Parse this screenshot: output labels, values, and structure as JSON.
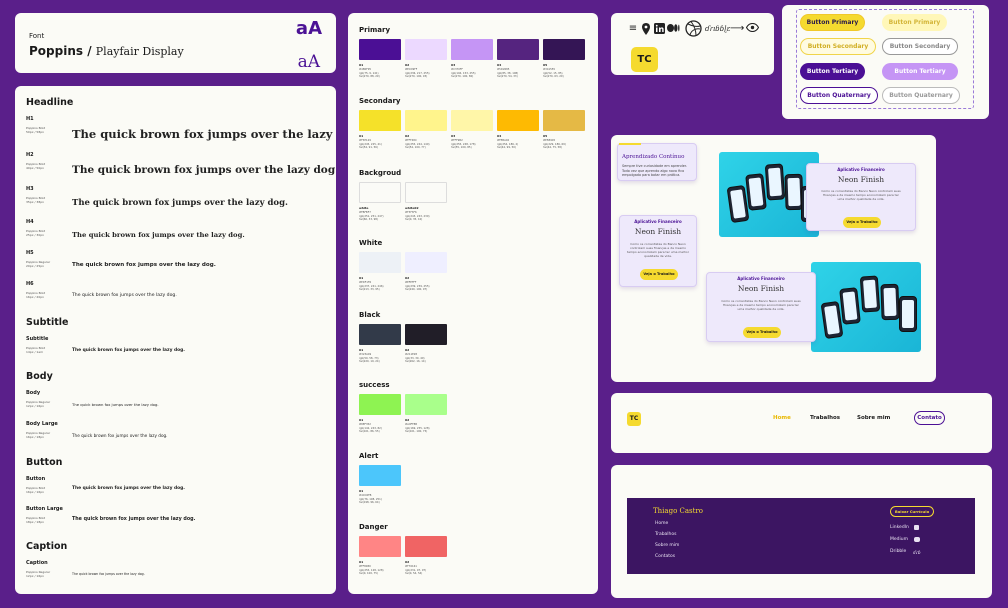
{
  "font": {
    "label": "Font",
    "family_a": "Poppins",
    "sep": " / ",
    "family_b": "Playfair Display",
    "aa_sans": "aA",
    "aa_serif": "aA"
  },
  "typography": {
    "sections": [
      {
        "title": "Headline"
      },
      {
        "title": "Subtitle"
      },
      {
        "title": "Body"
      },
      {
        "title": "Button"
      },
      {
        "title": "Caption"
      }
    ],
    "rows": [
      {
        "tag": "H1",
        "meta1": "Poppins Bold",
        "meta2": "50px / 58px",
        "sample": "The quick brown fox jumps over the lazy dog."
      },
      {
        "tag": "H2",
        "meta1": "Poppins Bold",
        "meta2": "40px / 50px",
        "sample": "The quick brown fox jumps over the lazy dog."
      },
      {
        "tag": "H3",
        "meta1": "Poppins Bold",
        "meta2": "35px / 38px",
        "sample": "The quick brown fox jumps over the lazy dog."
      },
      {
        "tag": "H4",
        "meta1": "Poppins Bold",
        "meta2": "25px / 30px",
        "sample": "The quick brown fox jumps over the lazy dog."
      },
      {
        "tag": "H5",
        "meta1": "Poppins Regular",
        "meta2": "20px / 25px",
        "sample": "The quick brown fox jumps over the lazy dog."
      },
      {
        "tag": "H6",
        "meta1": "Poppins Bold",
        "meta2": "16px / 20px",
        "sample": "The quick brown fox jumps over the lazy dog."
      },
      {
        "tag": "Subtitle",
        "meta1": "Poppins Bold",
        "meta2": "14px / 1em",
        "sample": "The quick brown fox jumps over the lazy dog."
      },
      {
        "tag": "Body",
        "meta1": "Poppins Regular",
        "meta2": "12px / 16px",
        "sample": "The quick brown fox jumps over the lazy dog."
      },
      {
        "tag": "Body Large",
        "meta1": "Poppins Regular",
        "meta2": "16px / 18px",
        "sample": "The quick brown fox jumps over the lazy dog."
      },
      {
        "tag": "Button",
        "meta1": "Poppins Bold",
        "meta2": "16px / 16px",
        "sample": "The quick brown fox jumps over the lazy dog."
      },
      {
        "tag": "Button Large",
        "meta1": "Poppins Bold",
        "meta2": "18px / 18px",
        "sample": "The quick brown fox jumps over the lazy dog."
      },
      {
        "tag": "Caption",
        "meta1": "Poppins Regular",
        "meta2": "12px / 16px",
        "sample": "The quick brown fox jumps over the lazy dog."
      }
    ]
  },
  "palette": {
    "groups": [
      {
        "name": "Primary",
        "swatches": [
          {
            "id": "01",
            "hex": "#4B0F95",
            "rgb": "rgb(75, 9, 141)",
            "hsl": "hsl(270, 88, 29)",
            "color": "#4b0f95"
          },
          {
            "id": "02",
            "hex": "#ECD9FF",
            "rgb": "rgb(236, 217, 255)",
            "hsl": "hsl(270, 100, 93)",
            "color": "#ecd9ff"
          },
          {
            "id": "03",
            "hex": "#C370FF",
            "rgb": "rgb(194, 153, 255)",
            "hsl": "hsl(270, 100, 80)",
            "color": "#c595f5"
          },
          {
            "id": "04",
            "hex": "#5D2685",
            "rgb": "rgb(85, 38, 108)",
            "hsl": "hsl(270, 54, 33)",
            "color": "#55247f"
          },
          {
            "id": "05",
            "hex": "#341555",
            "rgb": "rgb(52, 15, 85)",
            "hsl": "hsl(270, 63, 20)",
            "color": "#341555"
          }
        ]
      },
      {
        "name": "Secondary",
        "swatches": [
          {
            "id": "01",
            "hex": "#F5E129",
            "rgb": "rgb(245, 225, 41)",
            "hsl": "hsl(54, 91, 56)",
            "color": "#f5e129"
          },
          {
            "id": "02",
            "hex": "#FFF48C",
            "rgb": "rgb(255, 244, 140)",
            "hsl": "hsl(54, 100, 77)",
            "color": "#fff48c"
          },
          {
            "id": "03",
            "hex": "#FFF9B2",
            "rgb": "rgb(255, 248, 178)",
            "hsl": "hsl(55, 100, 85)",
            "color": "#fff6a8"
          },
          {
            "id": "04",
            "hex": "#FEBA02",
            "rgb": "rgb(254, 186, 2)",
            "hsl": "hsl(44, 99, 50)",
            "color": "#feba02"
          },
          {
            "id": "05",
            "hex": "#E5B945",
            "rgb": "rgb(229, 186, 69)",
            "hsl": "hsl(44, 75, 58)",
            "color": "#e5b945"
          }
        ]
      },
      {
        "name": "Backgroud",
        "swatches": [
          {
            "id": "white",
            "hex": "#FBFBF7",
            "rgb": "rgb(251, 251, 247)",
            "hsl": "hsl(60, 33, 98)",
            "color": "#fbfbf7"
          },
          {
            "id": "white02",
            "hex": "#F3F3F6",
            "rgb": "rgb(243, 243, 230)",
            "hsl": "hsl(0, 35, 10)",
            "color": "#fbfbf7"
          }
        ]
      },
      {
        "name": "White",
        "swatches": [
          {
            "id": "01",
            "hex": "#EDF1F6",
            "rgb": "rgb(237, 241, 246)",
            "hsl": "hsl(213, 33, 95)",
            "color": "#edf1f6"
          },
          {
            "id": "02",
            "hex": "#EFEFFF",
            "rgb": "rgb(239, 239, 255)",
            "hsl": "hsl(240, 100, 97)",
            "color": "#efefff"
          }
        ]
      },
      {
        "name": "Black",
        "swatches": [
          {
            "id": "01",
            "hex": "#323A49",
            "rgb": "rgb(50, 58, 73)",
            "hsl": "hsl(220, 19, 24)",
            "color": "#323a49"
          },
          {
            "id": "02",
            "hex": "#211E28",
            "rgb": "rgb(33, 30, 40)",
            "hsl": "hsl(262, 16, 14)",
            "color": "#211e28"
          }
        ]
      },
      {
        "name": "success",
        "swatches": [
          {
            "id": "01",
            "hex": "#8EF352",
            "rgb": "rgb(142, 243, 82)",
            "hsl": "hsl(101, 86, 55)",
            "color": "#8ef352"
          },
          {
            "id": "02",
            "hex": "#A9FF8B",
            "rgb": "rgb(169, 255, 128)",
            "hsl": "hsl(101, 100, 75)",
            "color": "#a9ff8b"
          }
        ]
      },
      {
        "name": "Alert",
        "swatches": [
          {
            "id": "01",
            "hex": "#4CC6FB",
            "rgb": "rgb(76, 198, 251)",
            "hsl": "hsl(198, 96, 64)",
            "color": "#4cc6fb"
          }
        ]
      },
      {
        "name": "Danger",
        "swatches": [
          {
            "id": "01",
            "hex": "#FF8080",
            "rgb": "rgb(255, 128, 128)",
            "hsl": "hsl(0, 100, 75)",
            "color": "#ff8585"
          },
          {
            "id": "02",
            "hex": "#F76161",
            "rgb": "rgb(231, 97, 97)",
            "hsl": "hsl(0, 54, 54)",
            "color": "#f06464"
          }
        ]
      }
    ]
  },
  "icons": {
    "list": [
      "menu-icon",
      "location-icon",
      "linkedin-icon",
      "medium-icon",
      "dribbble-icon",
      "dribbble-wordmark-icon",
      "arrow-right-icon",
      "eye-icon"
    ],
    "logo": "TC"
  },
  "buttons": {
    "primary": "Button Primary",
    "primary_ghost": "Button Primary",
    "secondary": "Button Secondary",
    "secondary_ghost": "Button Secondary",
    "tertiary": "Button Tertiary",
    "tertiary_ghost": "Button Tertiary",
    "quaternary": "Button Quaternary",
    "quaternary_ghost": "Button Quaternary"
  },
  "cards": {
    "learn_title": "Aprendizado Contínuo",
    "learn_text": "Sempre tive curiosidade em aprender. Todo vez que aprendo algo novo fico empolgado para botar em prática.",
    "finance_tag": "Aplicativo Financeiro",
    "finance_title": "Neon Finish",
    "finance_text": "Como os correntistas do Banco Neon controlam suas finanças e da mesmo tempo economizam para ter uma melhor qualidade de vida.",
    "finance_btn": "Veja o Trabalho"
  },
  "nav": {
    "logo": "TC",
    "home": "Home",
    "works": "Trabalhos",
    "about": "Sobre mim",
    "contact": "Contato"
  },
  "footer": {
    "name": "Thiago Castro",
    "links": [
      "Home",
      "Trabalhos",
      "Sobre mim",
      "Contatos"
    ],
    "cta": "Baixar Currículo",
    "social": [
      "LinkedIn",
      "Medium",
      "Dribble"
    ]
  },
  "colors": {
    "accent": "#4b0f95",
    "yellow": "#f5da2f",
    "bg": "#5a1f8a"
  }
}
